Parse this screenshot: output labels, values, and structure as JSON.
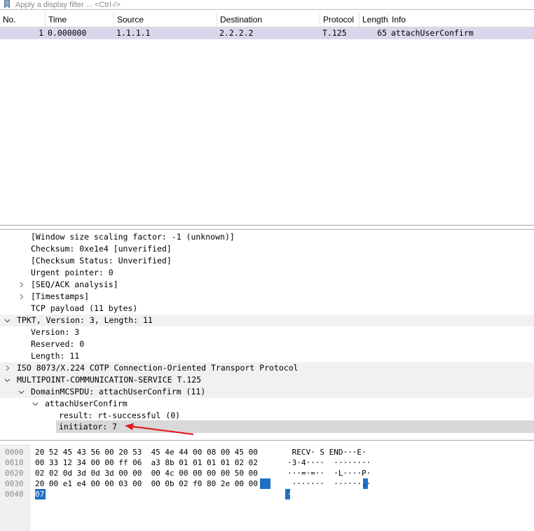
{
  "filter": {
    "placeholder": "Apply a display filter ... <Ctrl-/>",
    "value": ""
  },
  "packet_list": {
    "columns": [
      "No.",
      "Time",
      "Source",
      "Destination",
      "Protocol",
      "Length",
      "Info"
    ],
    "rows": [
      {
        "no": "1",
        "time": "0.000000",
        "source": "1.1.1.1",
        "destination": "2.2.2.2",
        "protocol": "T.125",
        "length": "65",
        "info": "attachUserConfirm"
      }
    ]
  },
  "details": {
    "lines": [
      {
        "text": "[Window size scaling factor: -1 (unknown)]",
        "toggle": "none"
      },
      {
        "text": "Checksum: 0xe1e4 [unverified]",
        "toggle": "none"
      },
      {
        "text": "[Checksum Status: Unverified]",
        "toggle": "none"
      },
      {
        "text": "Urgent pointer: 0",
        "toggle": "none"
      },
      {
        "text": "[SEQ/ACK analysis]",
        "toggle": "collapsed"
      },
      {
        "text": "[Timestamps]",
        "toggle": "collapsed"
      },
      {
        "text": "TCP payload (11 bytes)",
        "toggle": "none"
      },
      {
        "text": "TPKT, Version: 3, Length: 11",
        "toggle": "expanded"
      },
      {
        "text": "Version: 3",
        "toggle": "none"
      },
      {
        "text": "Reserved: 0",
        "toggle": "none"
      },
      {
        "text": "Length: 11",
        "toggle": "none"
      },
      {
        "text": "ISO 8073/X.224 COTP Connection-Oriented Transport Protocol",
        "toggle": "collapsed"
      },
      {
        "text": "MULTIPOINT-COMMUNICATION-SERVICE T.125",
        "toggle": "expanded"
      },
      {
        "text": "DomainMCSPDU: attachUserConfirm (11)",
        "toggle": "expanded"
      },
      {
        "text": "attachUserConfirm",
        "toggle": "expanded"
      },
      {
        "text": "result: rt-successful (0)",
        "toggle": "none"
      },
      {
        "text": "initiator: 7",
        "toggle": "none",
        "selected": true
      }
    ]
  },
  "bytes": {
    "offsets": [
      "0000",
      "0010",
      "0020",
      "0030",
      "0040"
    ],
    "hex": [
      "20 52 45 43 56 00 20 53  45 4e 44 00 08 00 45 00",
      "00 33 12 34 00 00 ff 06  a3 8b 01 01 01 01 02 02",
      "02 02 0d 3d 0d 3d 00 00  00 4c 00 00 00 00 50 00",
      "20 00 e1 e4 00 00 03 00  00 0b 02 f0 80 2e 00 00",
      "07"
    ],
    "ascii": [
      " RECV· S END···E·",
      "·3·4····  ········",
      "···=·=··  ·L····P·",
      " ·······  ······.·",
      "·"
    ]
  },
  "colors": {
    "row_selected": "#dcd6ec",
    "detail_selected": "#d9d9d9",
    "byte_highlight": "#1f6fc4",
    "annotation_arrow": "#e02020"
  }
}
